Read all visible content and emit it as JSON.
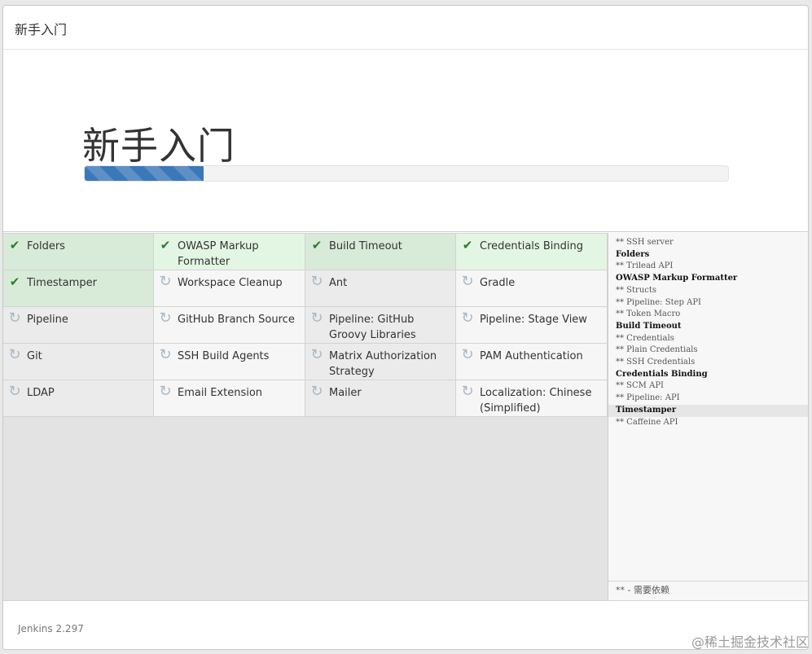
{
  "header": {
    "title": "新手入门"
  },
  "hero": {
    "title": "新手入门",
    "progress": 0.185
  },
  "plugins": [
    {
      "label": "Folders",
      "status": "done"
    },
    {
      "label": "OWASP Markup Formatter",
      "status": "done"
    },
    {
      "label": "Build Timeout",
      "status": "done"
    },
    {
      "label": "Credentials Binding",
      "status": "done"
    },
    {
      "label": "Timestamper",
      "status": "done"
    },
    {
      "label": "Workspace Cleanup",
      "status": "pending"
    },
    {
      "label": "Ant",
      "status": "pending"
    },
    {
      "label": "Gradle",
      "status": "pending"
    },
    {
      "label": "Pipeline",
      "status": "pending"
    },
    {
      "label": "GitHub Branch Source",
      "status": "pending"
    },
    {
      "label": "Pipeline: GitHub Groovy Libraries",
      "status": "pending"
    },
    {
      "label": "Pipeline: Stage View",
      "status": "pending"
    },
    {
      "label": "Git",
      "status": "pending"
    },
    {
      "label": "SSH Build Agents",
      "status": "pending"
    },
    {
      "label": "Matrix Authorization Strategy",
      "status": "pending"
    },
    {
      "label": "PAM Authentication",
      "status": "pending"
    },
    {
      "label": "LDAP",
      "status": "pending"
    },
    {
      "label": "Email Extension",
      "status": "pending"
    },
    {
      "label": "Mailer",
      "status": "pending"
    },
    {
      "label": "Localization: Chinese (Simplified)",
      "status": "pending"
    }
  ],
  "log": {
    "lines": [
      {
        "text": "** SSH server",
        "bold": false
      },
      {
        "text": "Folders",
        "bold": true
      },
      {
        "text": "** Trilead API",
        "bold": false
      },
      {
        "text": "OWASP Markup Formatter",
        "bold": true
      },
      {
        "text": "** Structs",
        "bold": false
      },
      {
        "text": "** Pipeline: Step API",
        "bold": false
      },
      {
        "text": "** Token Macro",
        "bold": false
      },
      {
        "text": "Build Timeout",
        "bold": true
      },
      {
        "text": "** Credentials",
        "bold": false
      },
      {
        "text": "** Plain Credentials",
        "bold": false
      },
      {
        "text": "** SSH Credentials",
        "bold": false
      },
      {
        "text": "Credentials Binding",
        "bold": true
      },
      {
        "text": "** SCM API",
        "bold": false
      },
      {
        "text": "** Pipeline: API",
        "bold": false
      },
      {
        "text": "Timestamper",
        "bold": true,
        "highlight": true
      },
      {
        "text": "** Caffeine API",
        "bold": false
      }
    ],
    "legend": "** - 需要依赖"
  },
  "footer": {
    "version": "Jenkins 2.297"
  },
  "watermark": "@稀土掘金技术社区",
  "colors": {
    "progress": "#3b78b9",
    "done_check": "#2d7a2d",
    "done_bg": "#d8ead8"
  },
  "icons": {
    "done": "check-icon",
    "pending": "refresh-icon"
  }
}
